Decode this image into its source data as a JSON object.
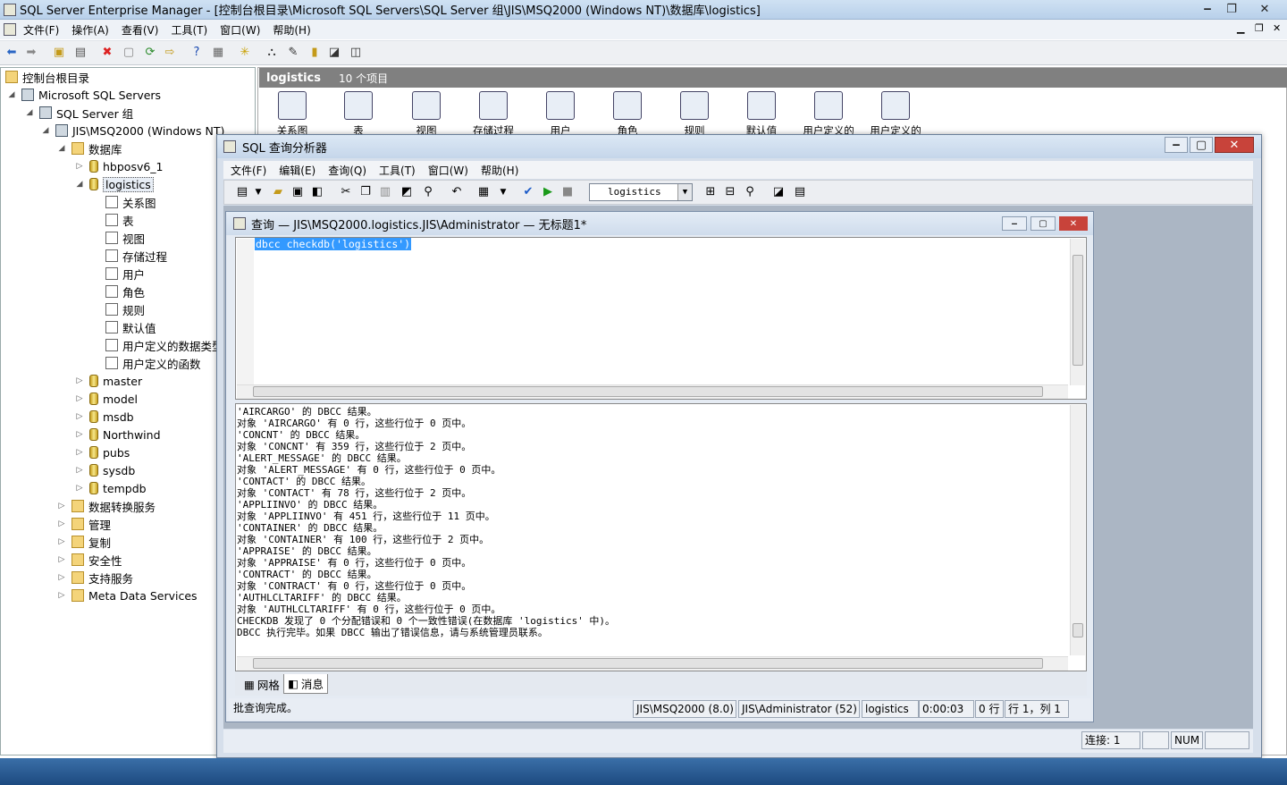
{
  "window": {
    "title": "SQL Server Enterprise Manager - [控制台根目录\\Microsoft SQL Servers\\SQL Server 组\\JIS\\MSQ2000 (Windows NT)\\数据库\\logistics]"
  },
  "menu": [
    "文件(F)",
    "操作(A)",
    "查看(V)",
    "工具(T)",
    "窗口(W)",
    "帮助(H)"
  ],
  "tree": {
    "root": "控制台根目录",
    "servers": "Microsoft SQL Servers",
    "group": "SQL Server 组",
    "instance": "JIS\\MSQ2000 (Windows NT)",
    "databases": "数据库",
    "db_hbp": "hbposv6_1",
    "db_log": "logistics",
    "objects": [
      "关系图",
      "表",
      "视图",
      "存储过程",
      "用户",
      "角色",
      "规则",
      "默认值",
      "用户定义的数据类型",
      "用户定义的函数"
    ],
    "other_dbs": [
      "master",
      "model",
      "msdb",
      "Northwind",
      "pubs",
      "sysdb",
      "tempdb"
    ],
    "folders": [
      "数据转换服务",
      "管理",
      "复制",
      "安全性",
      "支持服务",
      "Meta Data Services"
    ]
  },
  "rpane": {
    "title": "logistics",
    "count": "10 个项目",
    "items": [
      "关系图",
      "表",
      "视图",
      "存储过程",
      "用户",
      "角色",
      "规则",
      "默认值",
      "用户定义的",
      "用户定义的"
    ]
  },
  "qa": {
    "title": "SQL 查询分析器",
    "menu": [
      "文件(F)",
      "编辑(E)",
      "查询(Q)",
      "工具(T)",
      "窗口(W)",
      "帮助(H)"
    ],
    "db": "logistics",
    "child_title": "查询 — JIS\\MSQ2000.logistics.JIS\\Administrator — 无标题1*",
    "query": "dbcc checkdb('logistics')",
    "messages": [
      "'AIRCARGO' 的 DBCC 结果。",
      "对象 'AIRCARGO' 有 0 行，这些行位于 0 页中。",
      "'CONCNT' 的 DBCC 结果。",
      "对象 'CONCNT' 有 359 行，这些行位于 2 页中。",
      "'ALERT_MESSAGE' 的 DBCC 结果。",
      "对象 'ALERT_MESSAGE' 有 0 行，这些行位于 0 页中。",
      "'CONTACT' 的 DBCC 结果。",
      "对象 'CONTACT' 有 78 行，这些行位于 2 页中。",
      "'APPLIINVO' 的 DBCC 结果。",
      "对象 'APPLIINVO' 有 451 行，这些行位于 11 页中。",
      "'CONTAINER' 的 DBCC 结果。",
      "对象 'CONTAINER' 有 100 行，这些行位于 2 页中。",
      "'APPRAISE' 的 DBCC 结果。",
      "对象 'APPRAISE' 有 0 行，这些行位于 0 页中。",
      "'CONTRACT' 的 DBCC 结果。",
      "对象 'CONTRACT' 有 0 行，这些行位于 0 页中。",
      "'AUTHLCLTARIFF' 的 DBCC 结果。",
      "对象 'AUTHLCLTARIFF' 有 0 行，这些行位于 0 页中。",
      "CHECKDB 发现了 0 个分配错误和 0 个一致性错误(在数据库 'logistics' 中)。",
      "DBCC 执行完毕。如果 DBCC 输出了错误信息，请与系统管理员联系。"
    ],
    "tabs": [
      "网格",
      "消息"
    ],
    "status": {
      "msg": "批查询完成。",
      "server": "JIS\\MSQ2000 (8.0)",
      "user": "JIS\\Administrator (52)",
      "db": "logistics",
      "time": "0:00:03",
      "rows": "0 行",
      "pos": "行 1，列 1"
    },
    "app_status": {
      "conn": "连接: 1",
      "num": "NUM"
    }
  }
}
